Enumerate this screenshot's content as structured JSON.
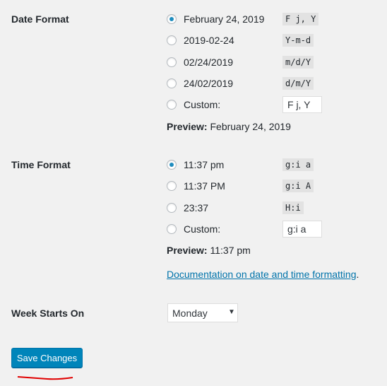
{
  "date_format": {
    "label": "Date Format",
    "options": [
      {
        "text": "February 24, 2019",
        "code": "F j, Y",
        "checked": true
      },
      {
        "text": "2019-02-24",
        "code": "Y-m-d",
        "checked": false
      },
      {
        "text": "02/24/2019",
        "code": "m/d/Y",
        "checked": false
      },
      {
        "text": "24/02/2019",
        "code": "d/m/Y",
        "checked": false
      }
    ],
    "custom_label": "Custom:",
    "custom_value": "F j, Y",
    "preview_label": "Preview:",
    "preview_value": "February 24, 2019"
  },
  "time_format": {
    "label": "Time Format",
    "options": [
      {
        "text": "11:37 pm",
        "code": "g:i a",
        "checked": true
      },
      {
        "text": "11:37 PM",
        "code": "g:i A",
        "checked": false
      },
      {
        "text": "23:37",
        "code": "H:i",
        "checked": false
      }
    ],
    "custom_label": "Custom:",
    "custom_value": "g:i a",
    "preview_label": "Preview:",
    "preview_value": "11:37 pm",
    "doc_link": "Documentation on date and time formatting",
    "doc_suffix": "."
  },
  "week": {
    "label": "Week Starts On",
    "selected": "Monday"
  },
  "save_label": "Save Changes",
  "colors": {
    "accent": "#0085ba",
    "annotation": "#e00000"
  }
}
